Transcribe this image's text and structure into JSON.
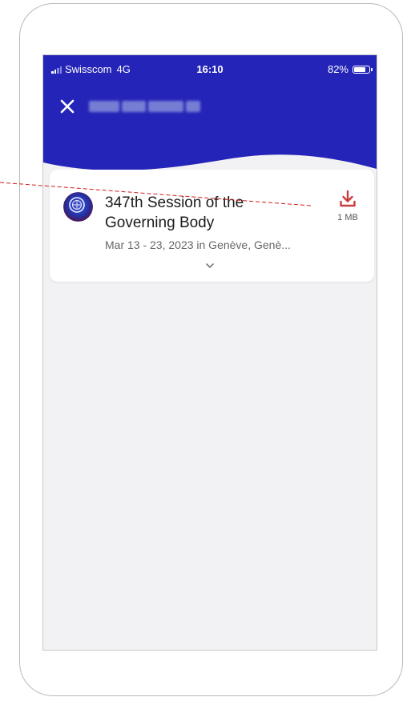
{
  "status_bar": {
    "carrier": "Swisscom",
    "network": "4G",
    "time": "16:10",
    "battery_percent": "82%",
    "battery_level": 0.82
  },
  "header": {
    "close_icon": "close-icon",
    "title": "",
    "background_color": "#2424b8"
  },
  "event": {
    "title": "347th Session of the Governing Body",
    "meta": "Mar 13 - 23, 2023 in Genève, Genè...",
    "download_icon": "download-icon",
    "download_size": "1 MB",
    "download_color": "#cc3a3a",
    "expand_icon": "chevron-down-icon"
  },
  "colors": {
    "annotation": "#d11a1a",
    "screen_background": "#f2f2f4"
  }
}
